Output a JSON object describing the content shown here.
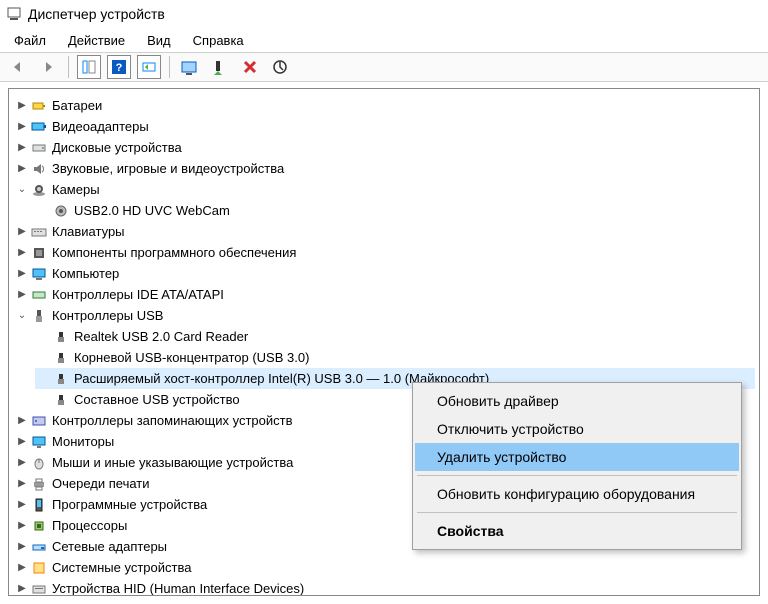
{
  "window": {
    "title": "Диспетчер устройств"
  },
  "menu": {
    "file": "Файл",
    "action": "Действие",
    "view": "Вид",
    "help": "Справка"
  },
  "tree": {
    "batteries": "Батареи",
    "video_adapters": "Видеоадаптеры",
    "disk_drives": "Дисковые устройства",
    "sound": "Звуковые, игровые и видеоустройства",
    "cameras": "Камеры",
    "camera_child": "USB2.0 HD UVC WebCam",
    "keyboards": "Клавиатуры",
    "software_components": "Компоненты программного обеспечения",
    "computer": "Компьютер",
    "ide": "Контроллеры IDE ATA/ATAPI",
    "usb": "Контроллеры USB",
    "usb_children": {
      "realtek": "Realtek USB 2.0 Card Reader",
      "root_hub": "Корневой USB-концентратор (USB 3.0)",
      "xhci": "Расширяемый хост-контроллер Intel(R) USB 3.0 — 1.0 (Майкрософт)",
      "composite": "Составное USB устройство"
    },
    "storage_controllers": "Контроллеры запоминающих устройств",
    "monitors": "Мониторы",
    "mice": "Мыши и иные указывающие устройства",
    "print_queues": "Очереди печати",
    "software_devices": "Программные устройства",
    "processors": "Процессоры",
    "network": "Сетевые адаптеры",
    "system_devices": "Системные устройства",
    "hid": "Устройства HID (Human Interface Devices)"
  },
  "context_menu": {
    "update_driver": "Обновить драйвер",
    "disable": "Отключить устройство",
    "uninstall": "Удалить устройство",
    "scan": "Обновить конфигурацию оборудования",
    "properties": "Свойства"
  }
}
